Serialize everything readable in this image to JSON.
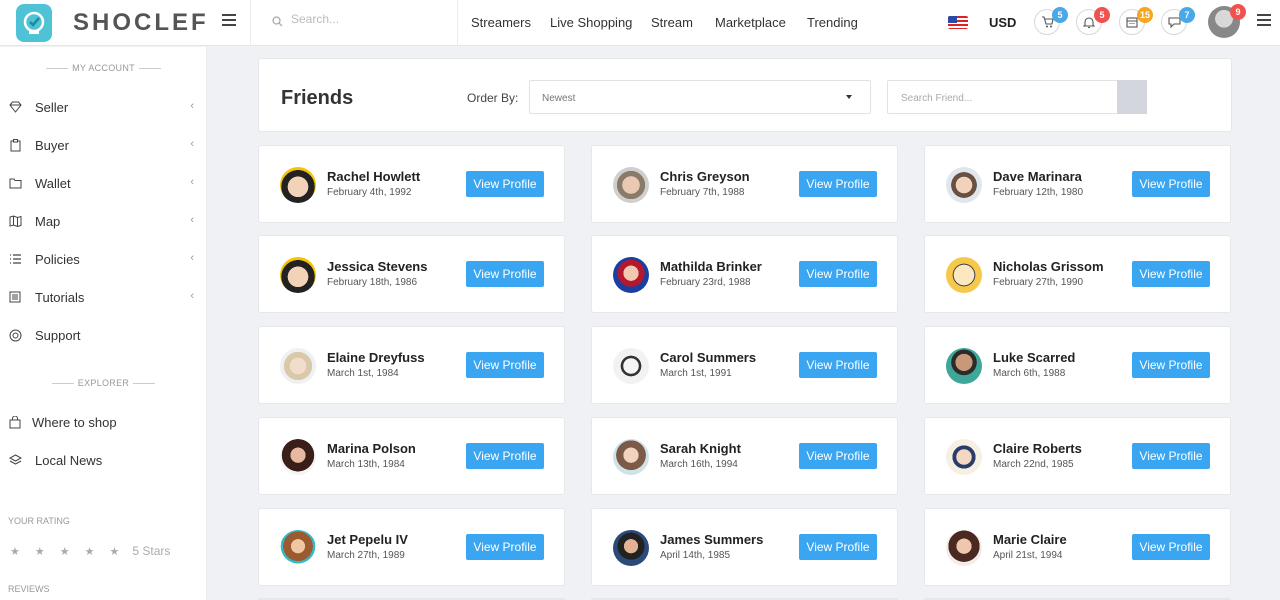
{
  "brand": {
    "name": "SHOCLEF"
  },
  "search": {
    "placeholder": "Search..."
  },
  "nav": [
    "Streamers",
    "Live Shopping",
    "Stream",
    "Marketplace",
    "Trending"
  ],
  "currency": "USD",
  "badges": {
    "cart": "5",
    "notifications": "5",
    "calendar": "15",
    "messages": "7",
    "profile": "9"
  },
  "colors": {
    "accent": "#3aa5f0",
    "logo": "#4fc3d5",
    "badge_blue": "#4aa8e8",
    "badge_red": "#ef5350",
    "badge_orange": "#f5a623"
  },
  "sidebar": {
    "account_heading": "MY ACCOUNT",
    "items": [
      {
        "label": "Seller",
        "icon": "diamond-icon"
      },
      {
        "label": "Buyer",
        "icon": "clipboard-icon"
      },
      {
        "label": "Wallet",
        "icon": "folder-icon"
      },
      {
        "label": "Map",
        "icon": "map-icon"
      },
      {
        "label": "Policies",
        "icon": "list-icon"
      },
      {
        "label": "Tutorials",
        "icon": "book-icon"
      },
      {
        "label": "Support",
        "icon": "lifebuoy-icon"
      }
    ],
    "explorer_heading": "EXPLORER",
    "explorer_items": [
      {
        "label": "Where to shop",
        "icon": "bag-icon"
      },
      {
        "label": "Local News",
        "icon": "layers-icon"
      }
    ],
    "rating_heading": "YOUR RATING",
    "rating_value": 0,
    "rating_text": "5 Stars",
    "reviews_heading": "REVIEWS"
  },
  "friends": {
    "title": "Friends",
    "order_label": "Order By:",
    "order_value": "Newest",
    "search_placeholder": "Search Friend...",
    "button_label": "View Profile",
    "list": [
      {
        "name": "Rachel Howlett",
        "date": "February 4th, 1992"
      },
      {
        "name": "Chris Greyson",
        "date": "February 7th, 1988"
      },
      {
        "name": "Dave Marinara",
        "date": "February 12th, 1980"
      },
      {
        "name": "Jessica Stevens",
        "date": "February 18th, 1986"
      },
      {
        "name": "Mathilda Brinker",
        "date": "February 23rd, 1988"
      },
      {
        "name": "Nicholas Grissom",
        "date": "February 27th, 1990"
      },
      {
        "name": "Elaine Dreyfuss",
        "date": "March 1st, 1984"
      },
      {
        "name": "Carol Summers",
        "date": "March 1st, 1991"
      },
      {
        "name": "Luke Scarred",
        "date": "March 6th, 1988"
      },
      {
        "name": "Marina Polson",
        "date": "March 13th, 1984"
      },
      {
        "name": "Sarah Knight",
        "date": "March 16th, 1994"
      },
      {
        "name": "Claire Roberts",
        "date": "March 22nd, 1985"
      },
      {
        "name": "Jet Pepelu IV",
        "date": "March 27th, 1989"
      },
      {
        "name": "James Summers",
        "date": "April 14th, 1985"
      },
      {
        "name": "Marie Claire",
        "date": "April 21st, 1994"
      }
    ]
  }
}
